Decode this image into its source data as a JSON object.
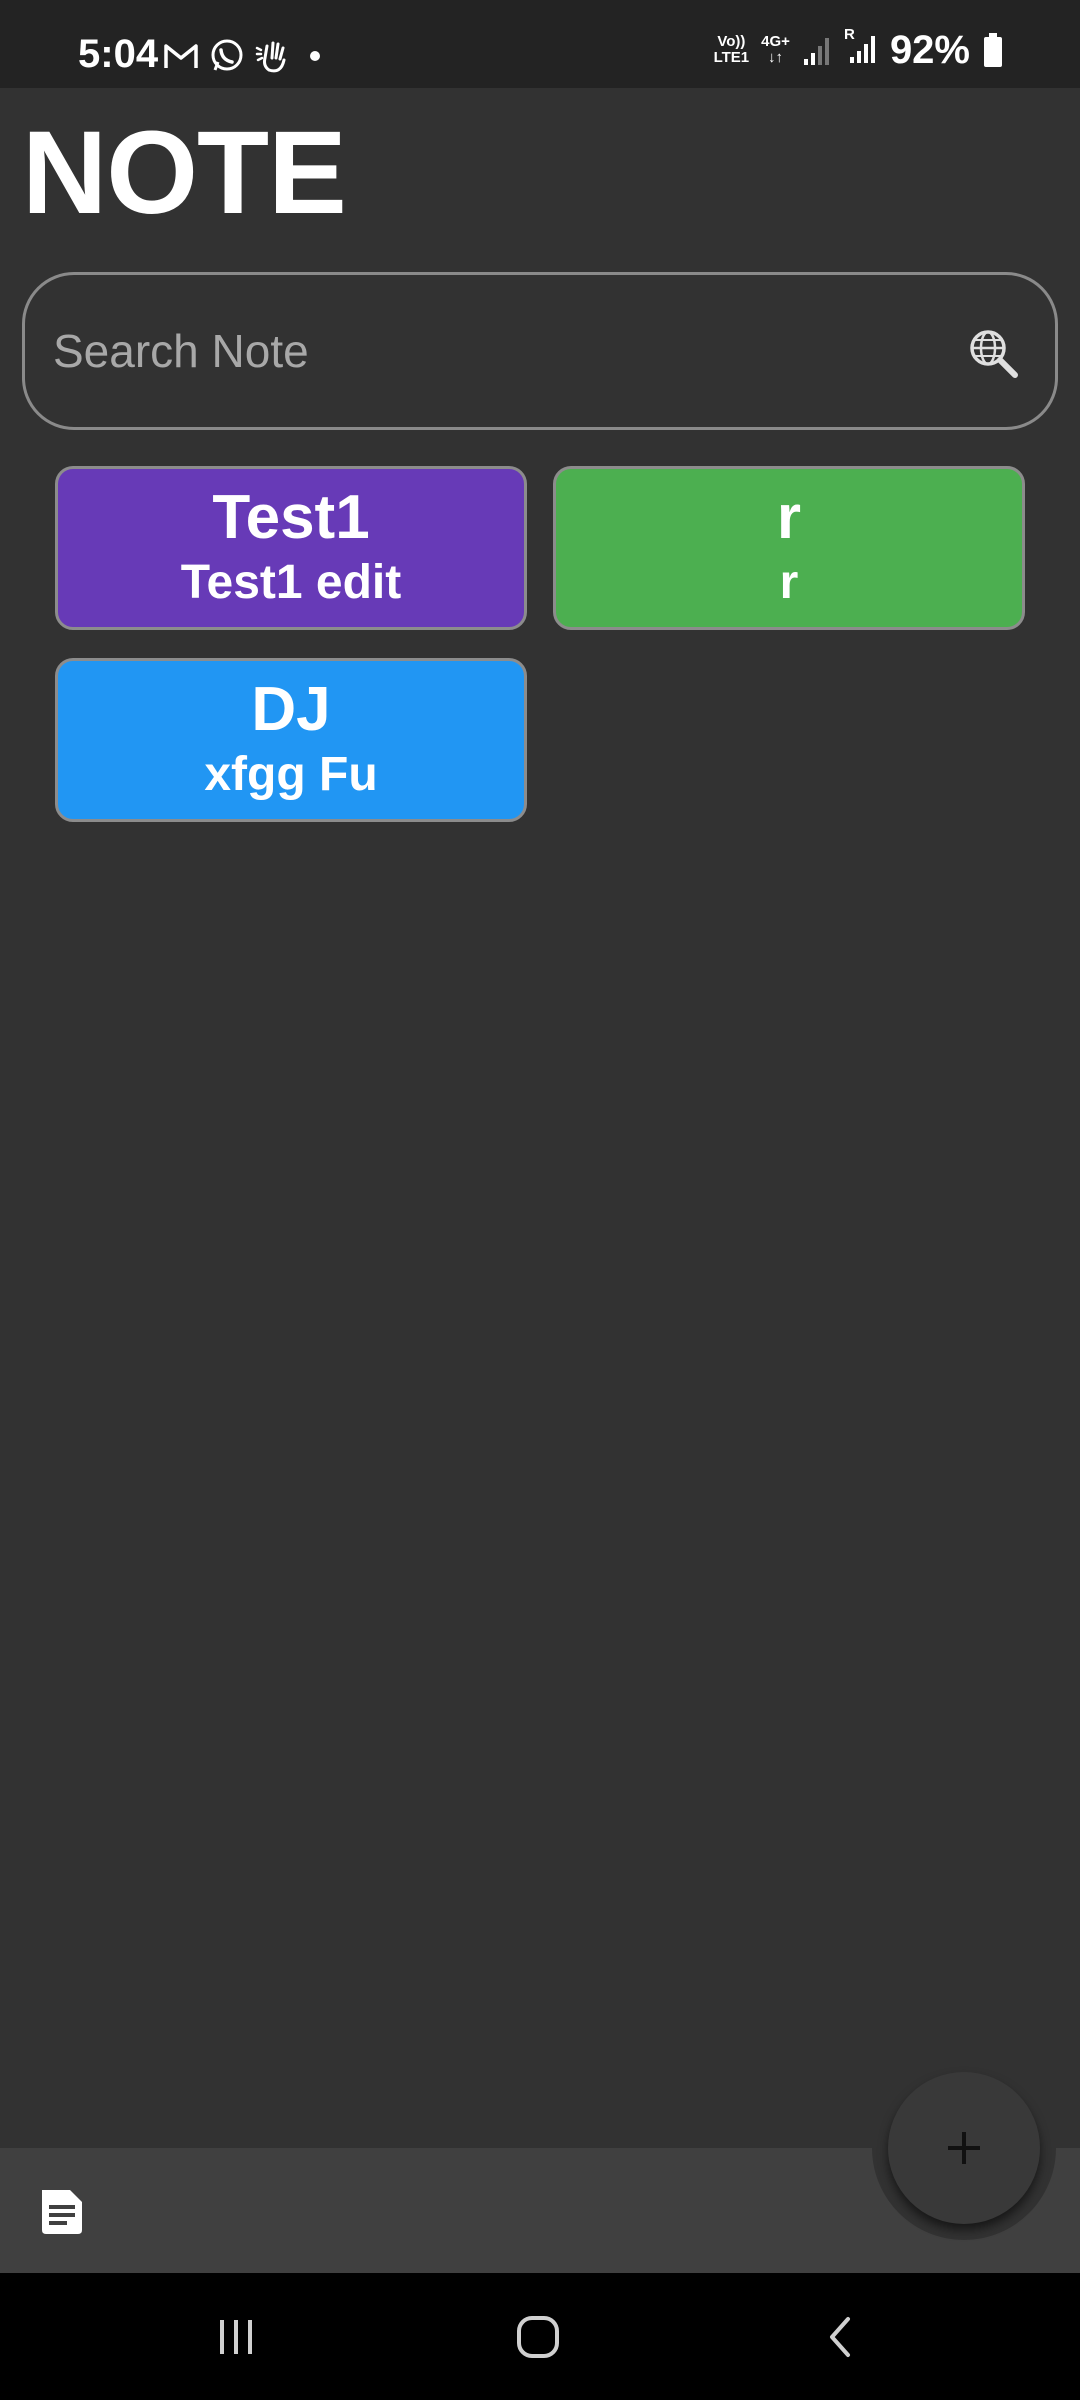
{
  "status_bar": {
    "time": "5:04",
    "network_top": "Vo))",
    "network_bottom": "LTE1",
    "data_top": "4G+",
    "data_bottom": "↓↑",
    "roaming": "R",
    "battery_percent": "92%",
    "icons": [
      "gmail-icon",
      "whatsapp-icon",
      "wave-hand-icon",
      "dot-icon",
      "signal-icon",
      "signal-roaming-icon",
      "battery-icon"
    ]
  },
  "page": {
    "title": "NOTE"
  },
  "search": {
    "placeholder": "Search Note",
    "value": "",
    "icon": "globe-search-icon"
  },
  "notes": [
    {
      "title": "Test1",
      "body": "Test1 edit",
      "color": "#673AB7"
    },
    {
      "title": "r",
      "body": "r",
      "color": "#4CAF50"
    },
    {
      "title": "DJ",
      "body": "xfgg Fu",
      "color": "#2196F3"
    }
  ],
  "bottom_bar": {
    "left_icon": "notes-list-icon",
    "fab_icon": "plus-icon"
  },
  "nav_bar": {
    "buttons": [
      "recents-icon",
      "home-icon",
      "back-icon"
    ]
  }
}
